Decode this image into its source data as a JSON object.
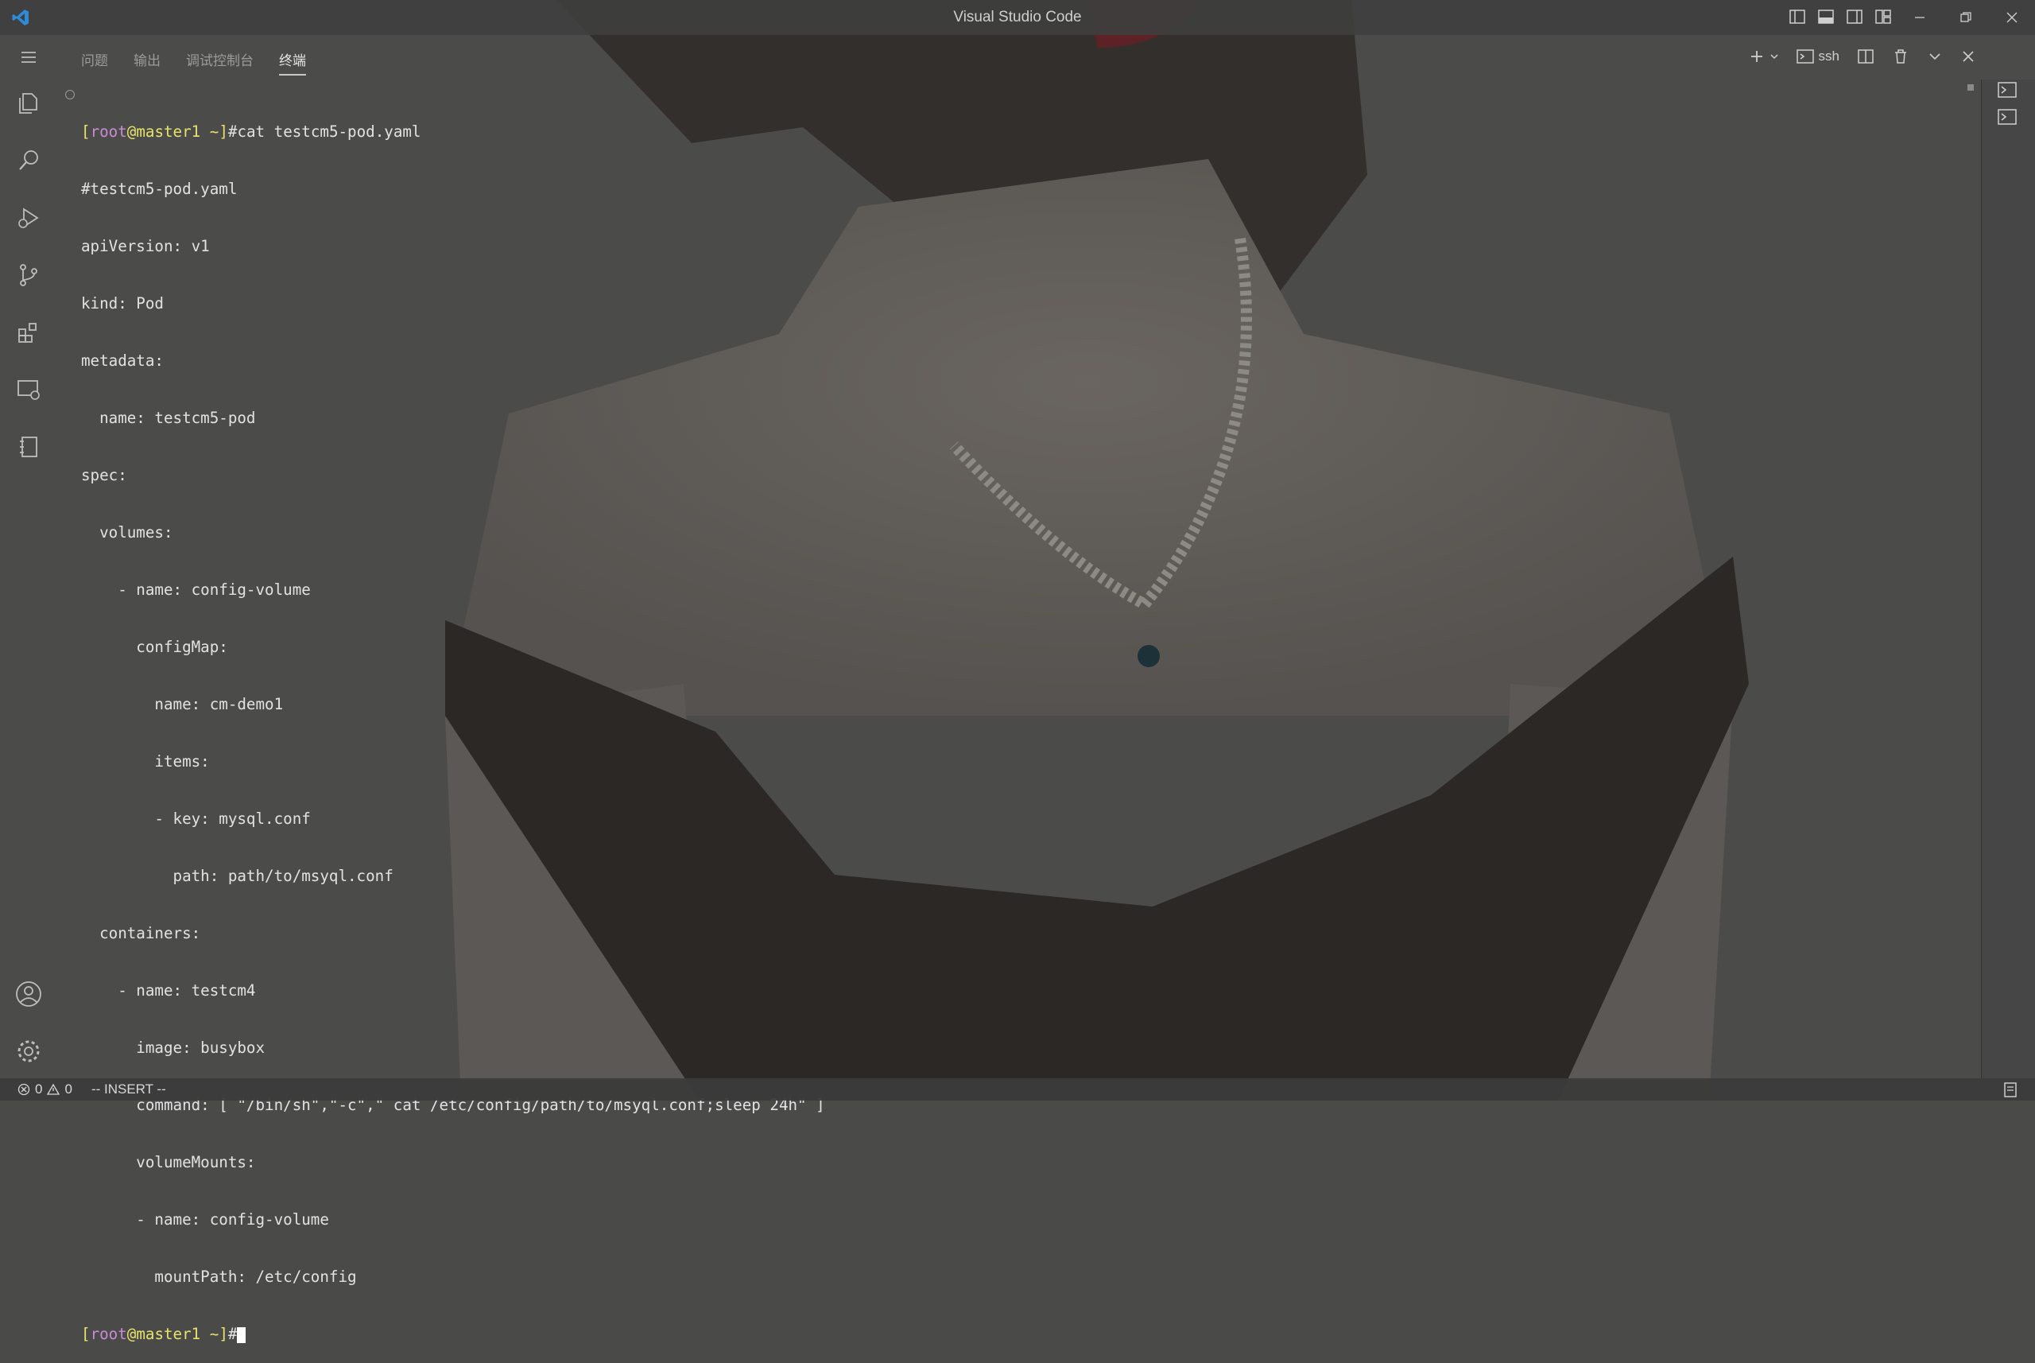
{
  "window": {
    "title": "Visual Studio Code"
  },
  "panel": {
    "tabs": [
      {
        "label": "问题",
        "active": false
      },
      {
        "label": "输出",
        "active": false
      },
      {
        "label": "调试控制台",
        "active": false
      },
      {
        "label": "终端",
        "active": true
      }
    ],
    "terminal_profile": "ssh"
  },
  "terminal": {
    "prompt": {
      "open": "[",
      "user": "root",
      "at": "@",
      "host": "master1 ~",
      "close": "]",
      "symbol": "#"
    },
    "command": "cat testcm5-pod.yaml",
    "output": [
      "#testcm5-pod.yaml",
      "apiVersion: v1",
      "kind: Pod",
      "metadata:",
      "  name: testcm5-pod",
      "spec:",
      "  volumes:",
      "    - name: config-volume",
      "      configMap:",
      "        name: cm-demo1",
      "        items:",
      "        - key: mysql.conf",
      "          path: path/to/msyql.conf",
      "  containers:",
      "    - name: testcm4",
      "      image: busybox",
      "      command: [ \"/bin/sh\",\"-c\",\" cat /etc/config/path/to/msyql.conf;sleep 24h\" ]",
      "      volumeMounts:",
      "      - name: config-volume",
      "        mountPath: /etc/config"
    ]
  },
  "statusbar": {
    "errors": "0",
    "warnings": "0",
    "mode": "-- INSERT --"
  },
  "icons": {
    "activity": [
      "explorer-icon",
      "search-icon",
      "run-debug-icon",
      "source-control-icon",
      "extensions-icon",
      "remote-explorer-icon",
      "notebook-icon",
      "account-icon",
      "settings-gear-icon"
    ]
  }
}
